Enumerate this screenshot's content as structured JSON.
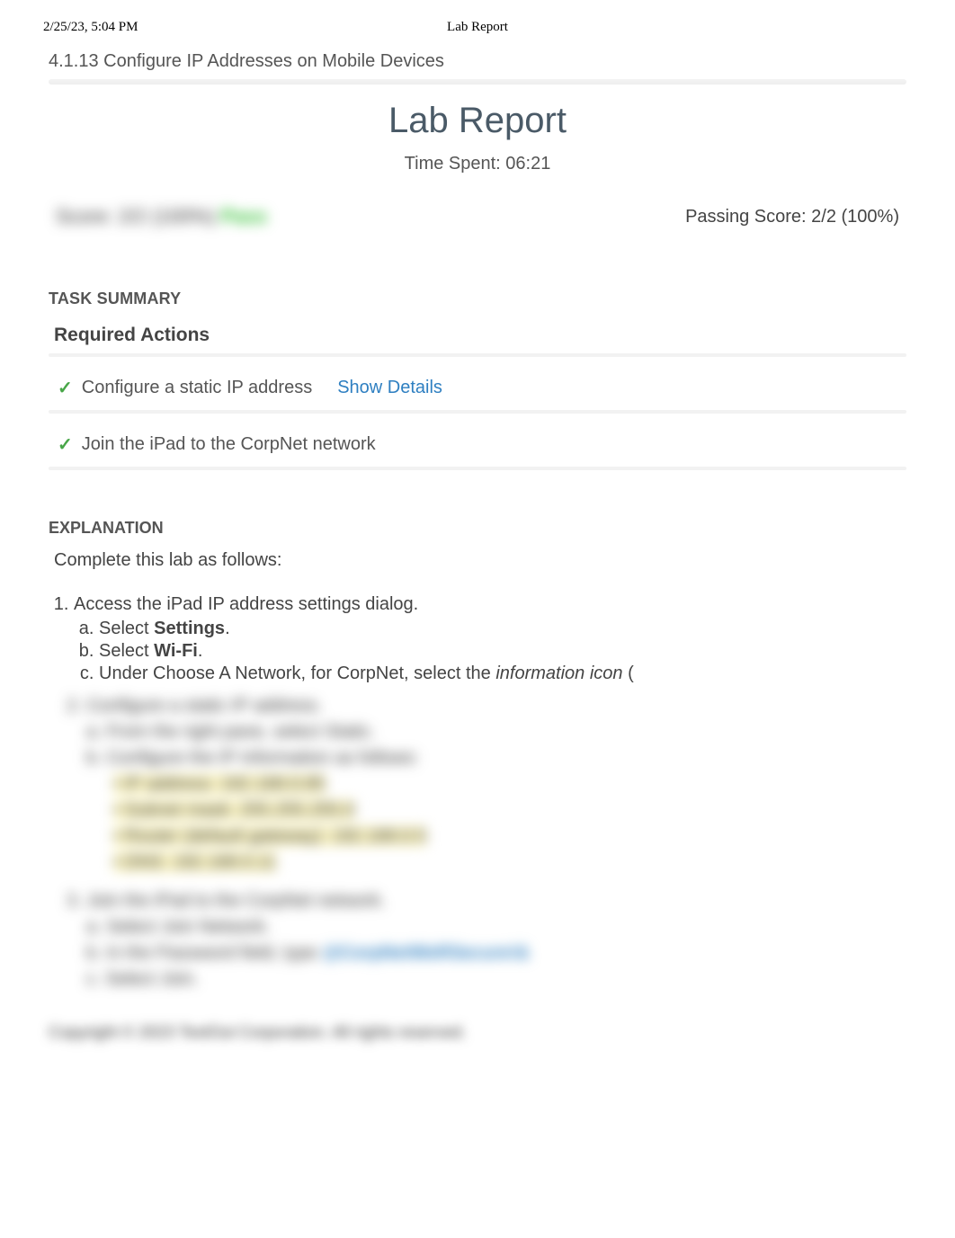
{
  "print": {
    "timestamp": "2/25/23, 5:04 PM",
    "doc_title": "Lab Report"
  },
  "header": {
    "breadcrumb": "4.1.13 Configure IP Addresses on Mobile Devices",
    "title": "Lab Report",
    "time_spent": "Time Spent: 06:21",
    "score_blurred": "Score: 2/2 (100%) ",
    "score_pass_word": "Pass",
    "passing_score": "Passing Score: 2/2 (100%)"
  },
  "task_summary": {
    "heading": "TASK SUMMARY",
    "required_heading": "Required Actions",
    "items": [
      {
        "label": "Configure a static IP address",
        "show_details": "Show Details"
      },
      {
        "label": "Join the iPad to the CorpNet network",
        "show_details": ""
      }
    ]
  },
  "explanation": {
    "heading": "EXPLANATION",
    "intro": "Complete this lab as follows:",
    "step1": {
      "text": "Access the iPad IP address settings dialog.",
      "a_pre": "Select ",
      "a_bold": "Settings",
      "a_post": ".",
      "b_pre": "Select ",
      "b_bold": "Wi-Fi",
      "b_post": ".",
      "c_pre": "Under Choose A Network, for CorpNet, select the ",
      "c_ital": "information icon",
      "c_post": " ("
    },
    "blurred_lines": [
      "2. Configure a static IP address.",
      "a. From the right pane, select Static.",
      "b. Configure the IP information as follows:",
      "• IP address: 192.168.0.85",
      "• Subnet mask: 255.255.255.0",
      "• Router (default gateway): 192.168.0.5",
      "• DNS: 192.168.0.11",
      "3. Join the iPad to the CorpNet network.",
      "a. Select Join Network.",
      "b. In the Password field, type @CorpNetWeRSecure!&",
      "c. Select Join."
    ],
    "copyright": "Copyright © 2023 TestOut Corporation. All rights reserved."
  }
}
